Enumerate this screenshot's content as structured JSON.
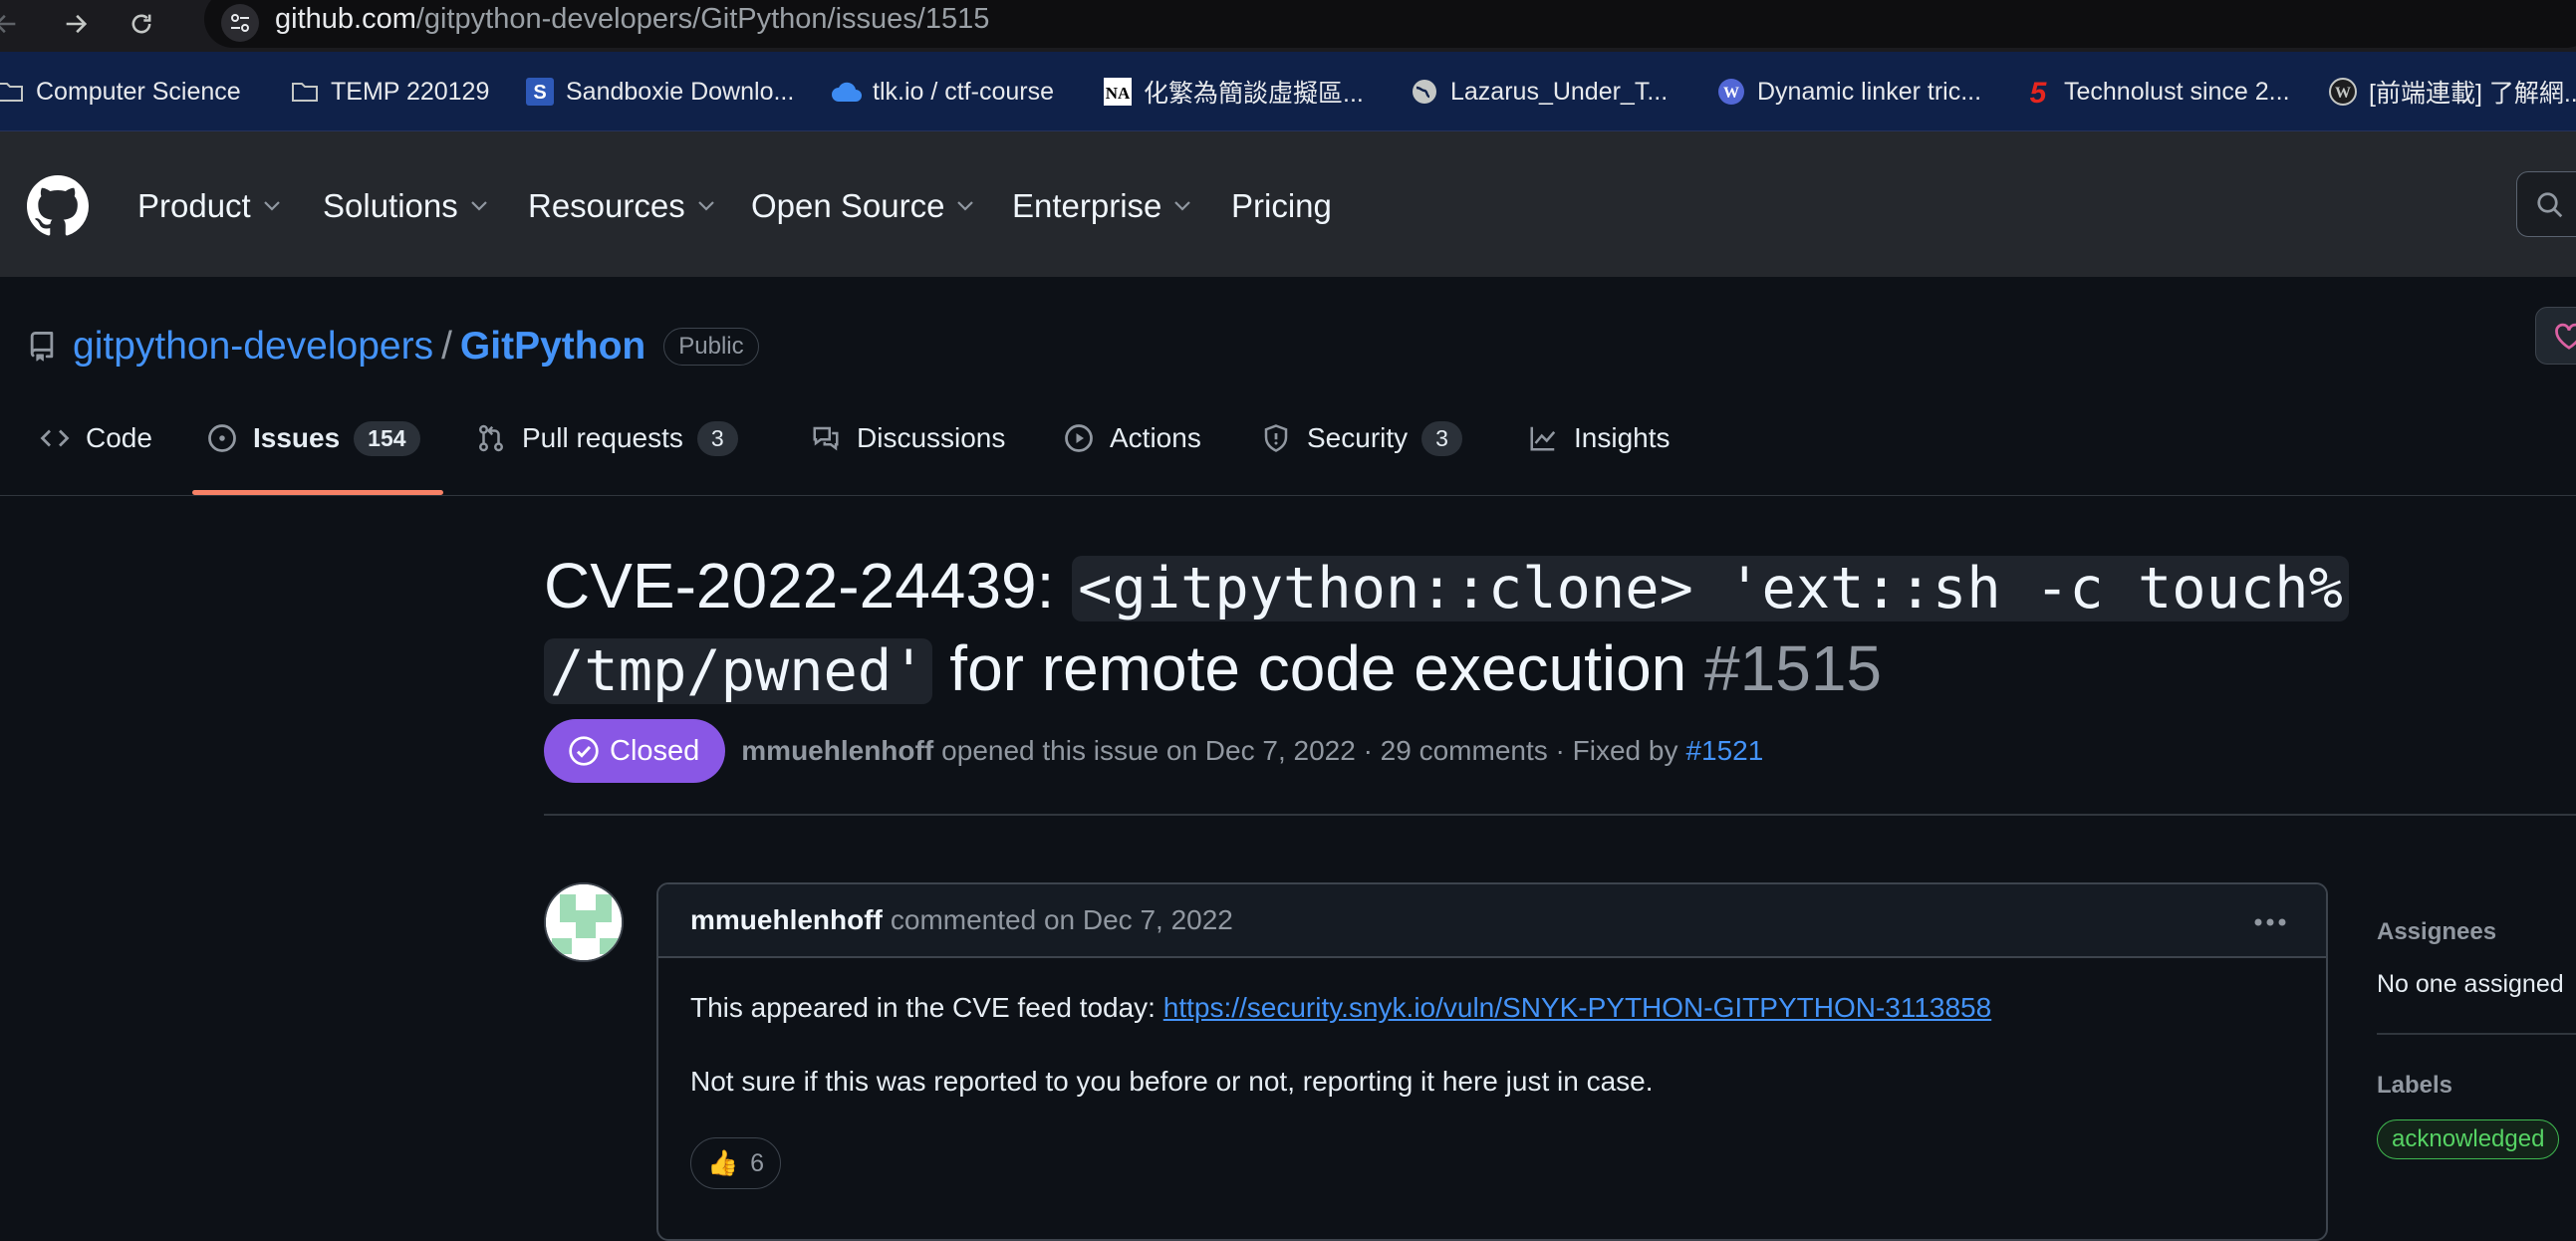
{
  "browser": {
    "url_host": "github.com",
    "url_path": "/gitpython-developers/GitPython/issues/1515",
    "bookmarks": [
      {
        "label": "Computer Science",
        "icon": "folder-icon"
      },
      {
        "label": "TEMP 220129",
        "icon": "folder-icon"
      },
      {
        "label": "Sandboxie Downlo...",
        "icon": "sandboxie-icon"
      },
      {
        "label": "tlk.io / ctf-course",
        "icon": "cloud-icon"
      },
      {
        "label": "化繁為簡談虛擬區...",
        "icon": "na-icon"
      },
      {
        "label": "Lazarus_Under_T...",
        "icon": "globe-icon"
      },
      {
        "label": "Dynamic linker tric...",
        "icon": "wordpress-icon"
      },
      {
        "label": "Technolust since 2...",
        "icon": "five-icon"
      },
      {
        "label": "[前端連載] 了解網...",
        "icon": "wordpress-icon"
      }
    ]
  },
  "header": {
    "nav": [
      "Product",
      "Solutions",
      "Resources",
      "Open Source",
      "Enterprise",
      "Pricing"
    ]
  },
  "repo": {
    "owner": "gitpython-developers",
    "separator": "/",
    "name": "GitPython",
    "visibility": "Public",
    "tabs": [
      {
        "label": "Code"
      },
      {
        "label": "Issues",
        "count": "154"
      },
      {
        "label": "Pull requests",
        "count": "3"
      },
      {
        "label": "Discussions"
      },
      {
        "label": "Actions"
      },
      {
        "label": "Security",
        "count": "3"
      },
      {
        "label": "Insights"
      }
    ]
  },
  "issue": {
    "title_prefix": "CVE-2022-24439: ",
    "title_code_1": "<gitpython::clone> 'ext::sh -c touch%",
    "title_code_2": "/tmp/pwned'",
    "title_suffix": " for remote code execution ",
    "number": "#1515",
    "state": "Closed",
    "author": "mmuehlenhoff",
    "meta_text": "opened this issue on Dec 7, 2022 · 29 comments · Fixed by",
    "fixed_by": "#1521"
  },
  "comment": {
    "author": "mmuehlenhoff",
    "action": "commented on Dec 7, 2022",
    "line1_text": "This appeared in the CVE feed today: ",
    "line1_link": "https://security.snyk.io/vuln/SNYK-PYTHON-GITPYTHON-3113858",
    "line2_text": "Not sure if this was reported to you before or not, reporting it here just in case.",
    "reaction_emoji": "👍",
    "reaction_count": "6"
  },
  "sidebar": {
    "assignees_heading": "Assignees",
    "assignees_value": "No one assigned",
    "labels_heading": "Labels",
    "label": "acknowledged"
  },
  "colors": {
    "accent_link": "#4493f8",
    "closed_purple": "#8957e5",
    "tab_underline": "#f78166",
    "label_green": "#3fb950"
  }
}
